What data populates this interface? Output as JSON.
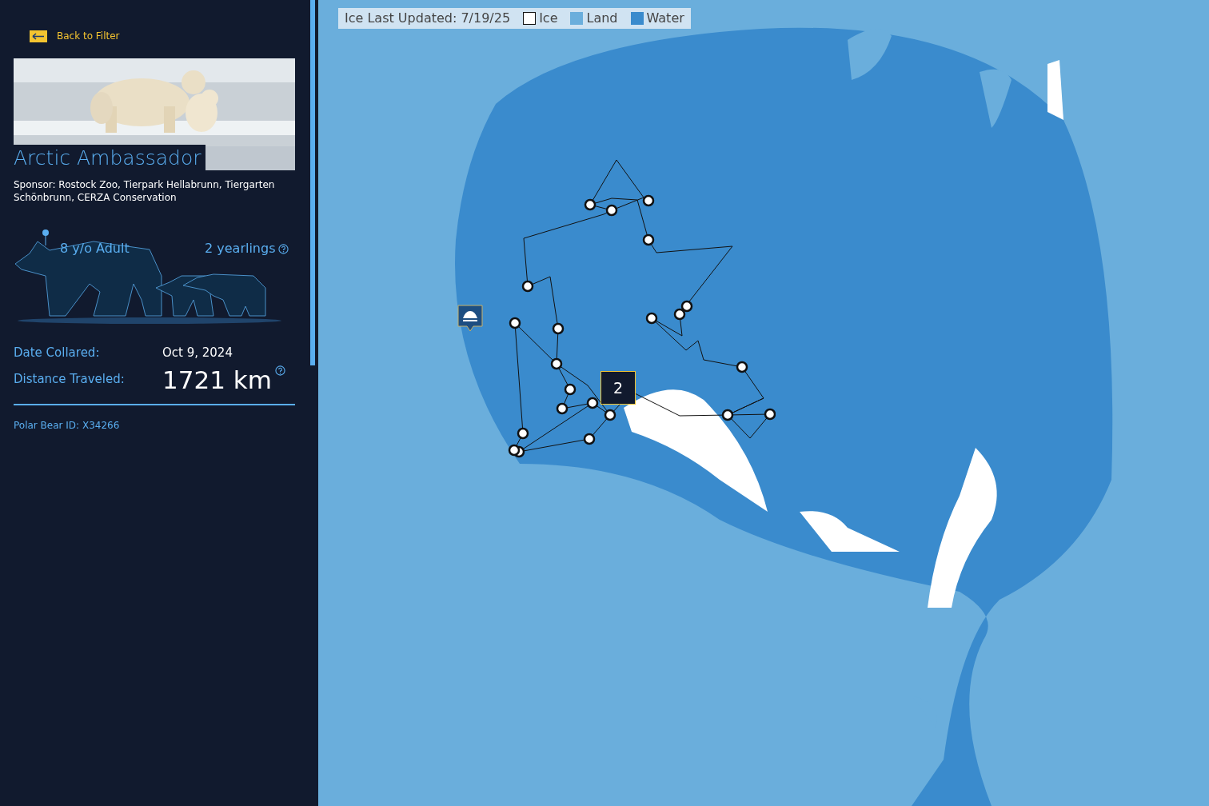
{
  "sidebar": {
    "back_link": "Back to Filter",
    "title": "Arctic Ambassador",
    "sponsor": "Sponsor: Rostock Zoo, Tierpark Hellabrunn, Tiergarten Schönbrunn, CERZA Conservation",
    "age_label": "8 y/o Adult",
    "cubs_label": "2 yearlings",
    "facts": [
      {
        "label": "Date Collared:",
        "value": "Oct 9, 2024",
        "kind": "date"
      },
      {
        "label": "Distance Traveled:",
        "value": "1721 km",
        "kind": "distance"
      }
    ],
    "bear_id": "Polar Bear ID: X34266"
  },
  "map": {
    "legend": {
      "title": "Ice Last Updated: 7/19/25",
      "items": [
        {
          "label": "Ice",
          "color": "#ffffff"
        },
        {
          "label": "Land",
          "color": "#6aaedc"
        },
        {
          "label": "Water",
          "color": "#3a8bcd"
        }
      ]
    },
    "cluster_marker": "2"
  }
}
